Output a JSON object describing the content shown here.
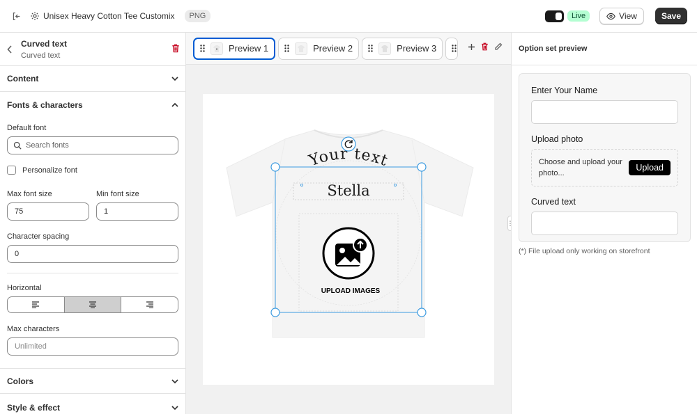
{
  "topbar": {
    "product_title": "Unisex Heavy Cotton Tee Customix",
    "format_badge": "PNG",
    "live_label": "Live",
    "view_label": "View",
    "save_label": "Save"
  },
  "left": {
    "title": "Curved text",
    "subtitle": "Curved text",
    "sections": {
      "content": "Content",
      "fonts": "Fonts & characters",
      "colors": "Colors",
      "style": "Style & effect"
    },
    "default_font_label": "Default font",
    "search_placeholder": "Search fonts",
    "personalize_label": "Personalize font",
    "max_font_label": "Max font size",
    "max_font_value": "75",
    "min_font_label": "Min font size",
    "min_font_value": "1",
    "char_spacing_label": "Character spacing",
    "char_spacing_value": "0",
    "horizontal_label": "Horizontal",
    "horizontal_selected": "center",
    "max_chars_label": "Max characters",
    "max_chars_placeholder": "Unlimited"
  },
  "center": {
    "tabs": [
      {
        "label": "Preview 1",
        "active": true
      },
      {
        "label": "Preview 2",
        "active": false
      },
      {
        "label": "Preview 3",
        "active": false
      }
    ],
    "curved_text": "Your text",
    "name_text": "Stella",
    "upload_images_label": "UPLOAD IMAGES"
  },
  "right": {
    "title": "Option set preview",
    "name_label": "Enter Your Name",
    "photo_label": "Upload photo",
    "upload_hint": "Choose and upload your photo...",
    "upload_button": "Upload",
    "curved_label": "Curved text",
    "note": "(*) File upload only working on storefront"
  },
  "colors": {
    "accent": "#005bd3",
    "danger": "#c70a24",
    "live_bg": "#b4fed2",
    "selection": "#3a9ae0"
  }
}
